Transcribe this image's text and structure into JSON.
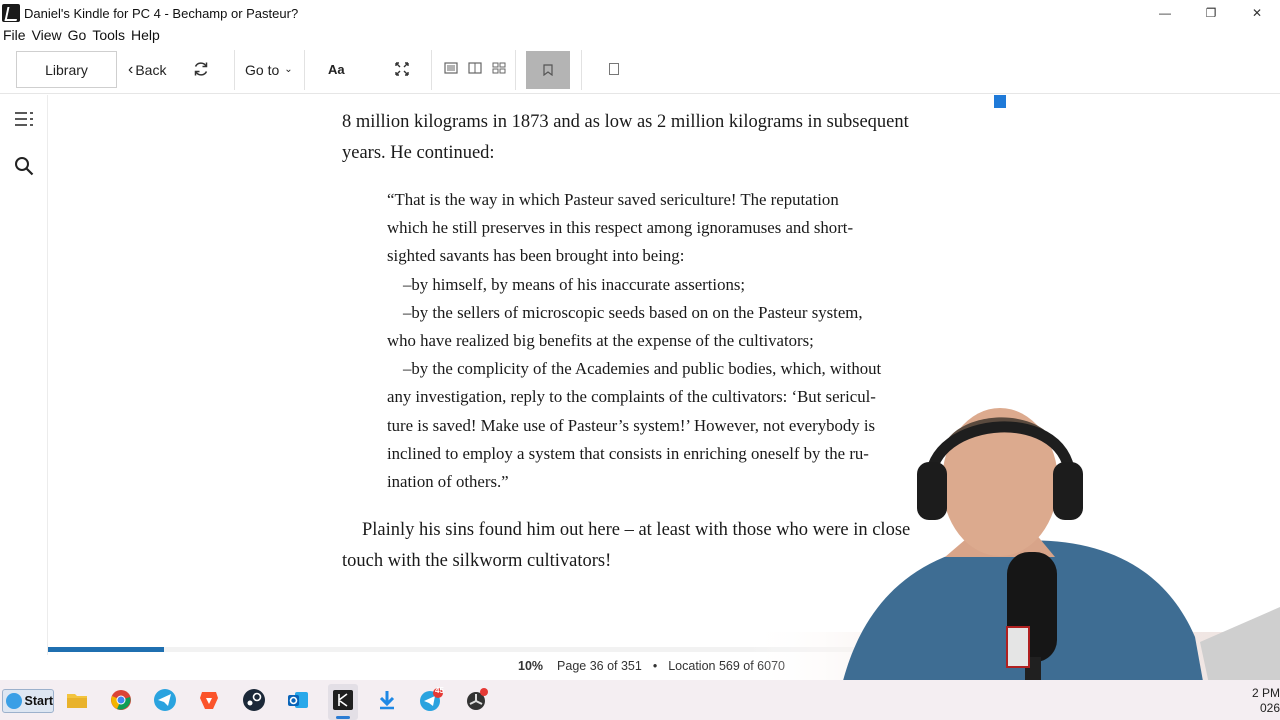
{
  "window": {
    "title": "Daniel's Kindle for PC 4 - Bechamp or Pasteur?",
    "controls": {
      "minimize": "—",
      "restore": "❐",
      "close": "✕"
    }
  },
  "menu": {
    "items": [
      "File",
      "View",
      "Go",
      "Tools",
      "Help"
    ]
  },
  "toolbar": {
    "library_label": "Library",
    "back_label": "Back",
    "goto_label": "Go to",
    "font_label": "Aa"
  },
  "icons": [
    "app-kindle-icon",
    "sync-icon",
    "fullscreen-icon",
    "single-column-icon",
    "two-column-icon",
    "grid-view-icon",
    "bookmark-icon",
    "notes-icon",
    "table-of-contents-icon",
    "search-icon"
  ],
  "book": {
    "para1": [
      "8 million kilograms in 1873 and as low as 2 million kilograms in subsequent",
      "years. He continued:"
    ],
    "quote": [
      {
        "text": "“That is the way in which Pasteur saved sericulture! The reputation",
        "indent": false
      },
      {
        "text": "which he still preserves in this respect among ignoramuses and short-",
        "indent": false
      },
      {
        "text": "sighted savants has been brought into being:",
        "indent": false
      },
      {
        "text": "–by himself, by means of his inaccurate assertions;",
        "indent": true
      },
      {
        "text": "–by the sellers of microscopic seeds based on on the Pasteur system,",
        "indent": true
      },
      {
        "text": "who have realized big benefits at the expense of the cultivators;",
        "indent": false
      },
      {
        "text": "–by the complicity of the Academies and public bodies, which, without",
        "indent": true
      },
      {
        "text": "any investigation, reply to the complaints of the cultivators: ‘But sericul-",
        "indent": false
      },
      {
        "text": "ture is saved! Make use of Pasteur’s system!’ However, not everybody is",
        "indent": false
      },
      {
        "text": "inclined to employ a system that consists in enriching oneself by the ru-",
        "indent": false
      },
      {
        "text": "ination of others.”",
        "indent": false
      }
    ],
    "para2": [
      "Plainly his sins found him out here – at least with those who were in close",
      "touch with the silkworm cultivators!"
    ]
  },
  "status": {
    "percent": "10%",
    "page": "Page 36 of 351",
    "separator": "•",
    "location": "Location 569 of 6070",
    "progress_fraction": 0.094
  },
  "taskbar": {
    "start_label": "Start",
    "apps": [
      "file-explorer-icon",
      "chrome-icon",
      "telegram-icon",
      "brave-icon",
      "steam-icon",
      "outlook-icon",
      "kindle-icon",
      "download-icon",
      "telegram-badge-icon",
      "unknown-app-icon"
    ],
    "telegram_badge": "45",
    "clock_time": "2 PM",
    "clock_date": "026"
  },
  "colors": {
    "accent": "#1f6fb0",
    "page_marker": "#1f7ad8",
    "bookmark_active_bg": "#b4b4b4",
    "taskbar_bg": "#f4eef2"
  }
}
